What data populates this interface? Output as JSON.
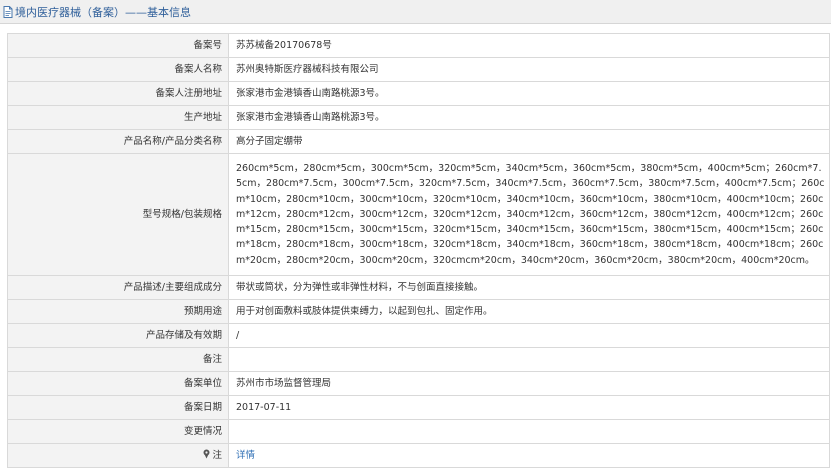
{
  "header": {
    "icon": "document-icon",
    "title": "境内医疗器械（备案）——基本信息"
  },
  "rows": [
    {
      "label": "备案号",
      "value": "苏苏械备20170678号"
    },
    {
      "label": "备案人名称",
      "value": "苏州奥特斯医疗器械科技有限公司"
    },
    {
      "label": "备案人注册地址",
      "value": "张家港市金港镇香山南路桃源3号。"
    },
    {
      "label": "生产地址",
      "value": "张家港市金港镇香山南路桃源3号。"
    },
    {
      "label": "产品名称/产品分类名称",
      "value": "高分子固定绷带"
    },
    {
      "label": "型号规格/包装规格",
      "value": "260cm*5cm，280cm*5cm，300cm*5cm，320cm*5cm，340cm*5cm，360cm*5cm，380cm*5cm，400cm*5cm；260cm*7.5cm，280cm*7.5cm，300cm*7.5cm，320cm*7.5cm，340cm*7.5cm，360cm*7.5cm，380cm*7.5cm，400cm*7.5cm；260cm*10cm，280cm*10cm，300cm*10cm，320cm*10cm，340cm*10cm，360cm*10cm，380cm*10cm，400cm*10cm；260cm*12cm，280cm*12cm，300cm*12cm，320cm*12cm，340cm*12cm，360cm*12cm，380cm*12cm，400cm*12cm；260cm*15cm，280cm*15cm，300cm*15cm，320cm*15cm，340cm*15cm，360cm*15cm，380cm*15cm，400cm*15cm；260cm*18cm，280cm*18cm，300cm*18cm，320cm*18cm，340cm*18cm，360cm*18cm，380cm*18cm，400cm*18cm；260cm*20cm，280cm*20cm，300cm*20cm，320cmcm*20cm，340cm*20cm，360cm*20cm，380cm*20cm，400cm*20cm。"
    },
    {
      "label": "产品描述/主要组成成分",
      "value": "带状或筒状，分为弹性或非弹性材料，不与创面直接接触。"
    },
    {
      "label": "预期用途",
      "value": "用于对创面敷料或肢体提供束缚力，以起到包扎、固定作用。"
    },
    {
      "label": "产品存储及有效期",
      "value": "/"
    },
    {
      "label": "备注",
      "value": ""
    },
    {
      "label": "备案单位",
      "value": "苏州市市场监督管理局"
    },
    {
      "label": "备案日期",
      "value": "2017-07-11"
    },
    {
      "label": "变更情况",
      "value": ""
    }
  ],
  "note_row": {
    "icon": "pin-icon",
    "label": "注",
    "link_text": "详情"
  },
  "colors": {
    "header_bg": "#f0f0f0",
    "title": "#2f5f9a",
    "label_bg": "#f3f3f3",
    "border": "#d9d9d9",
    "link": "#2f6fb5"
  }
}
